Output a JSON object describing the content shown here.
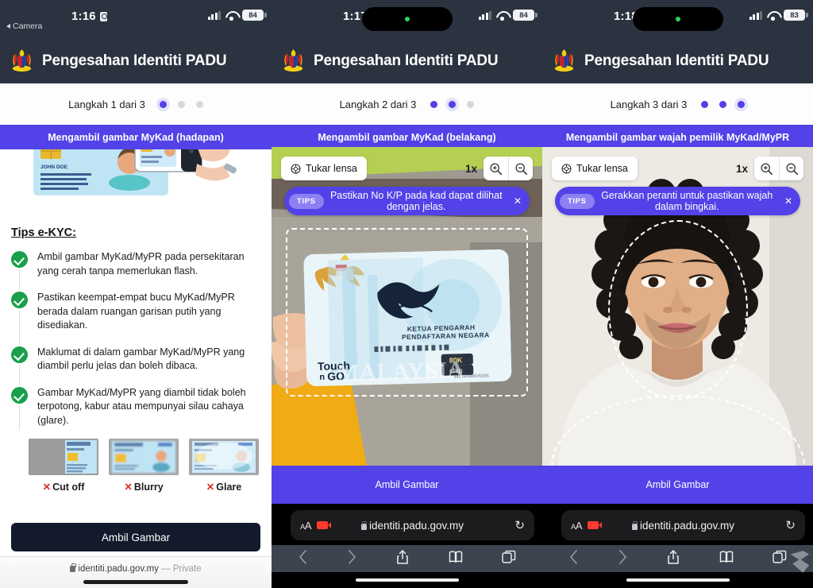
{
  "app": {
    "title": "Pengesahan Identiti PADU",
    "logo_icon": "malaysia-coat-of-arms-icon",
    "url": "identiti.padu.gov.my",
    "private_label": "— Private"
  },
  "panels": [
    {
      "id": "step1",
      "status_bar": {
        "time": "1:16",
        "back_label": "Camera",
        "battery": "84",
        "signal_icon": "cellular-bars-icon",
        "wifi_icon": "wifi-icon",
        "lock_icon": "screen-lock-icon",
        "has_dynamic_island": false
      },
      "step_label": "Langkah 1 dari 3",
      "step_current": 1,
      "step_total": 3,
      "band_title": "Mengambil gambar MyKad (hadapan)",
      "hero_image_alt": "mykad-photo-illustration",
      "tips_title": "Tips e-KYC:",
      "tips": [
        "Ambil gambar MyKad/MyPR pada persekitaran yang cerah tanpa memerlukan flash.",
        "Pastikan keempat-empat bucu MyKad/MyPR berada dalam ruangan garisan putih yang disediakan.",
        "Maklumat di dalam gambar MyKad/MyPR yang diambil perlu jelas dan boleh dibaca.",
        "Gambar MyKad/MyPR yang diambil tidak boleh terpotong, kabur atau mempunyai silau cahaya (glare)."
      ],
      "bad_examples": [
        {
          "label": "Cut off",
          "mark": "✕",
          "thumb": "mykad-cutoff-thumb"
        },
        {
          "label": "Blurry",
          "mark": "✕",
          "thumb": "mykad-blurry-thumb"
        },
        {
          "label": "Glare",
          "mark": "✕",
          "thumb": "mykad-glare-thumb"
        }
      ],
      "capture_button": "Ambil Gambar"
    },
    {
      "id": "step2",
      "status_bar": {
        "time": "1:17",
        "battery": "84",
        "signal_icon": "cellular-bars-icon",
        "wifi_icon": "wifi-icon",
        "lock_icon": "screen-lock-icon",
        "has_dynamic_island": true
      },
      "step_label": "Langkah 2 dari 3",
      "step_current": 2,
      "step_total": 3,
      "band_title": "Mengambil gambar MyKad (belakang)",
      "lens_button": "Tukar lensa",
      "lens_icon": "camera-lens-icon",
      "zoom_level": "1x",
      "zoom_in_icon": "magnifier-plus-icon",
      "zoom_out_icon": "magnifier-minus-icon",
      "tips_pill": "TIPS",
      "tips_message": "Pastikan No K/P pada kad dapat dilihat dengan jelas.",
      "tips_close_icon": "close-icon",
      "guide_shape": "rectangle",
      "capture_button": "Ambil Gambar",
      "browser": {
        "aa_label": "AA",
        "camera_active_icon": "camera-recording-icon",
        "lock_icon": "lock-icon",
        "url": "identiti.padu.gov.my",
        "reload_icon": "reload-icon",
        "tools": [
          "back-icon",
          "forward-icon",
          "share-icon",
          "bookmarks-icon",
          "tabs-icon"
        ]
      }
    },
    {
      "id": "step3",
      "status_bar": {
        "time": "1:18",
        "battery": "83",
        "signal_icon": "cellular-bars-icon",
        "wifi_icon": "wifi-icon",
        "lock_icon": "screen-lock-icon",
        "has_dynamic_island": true
      },
      "step_label": "Langkah 3 dari 3",
      "step_current": 3,
      "step_total": 3,
      "band_title": "Mengambil gambar wajah pemilik MyKad/MyPR",
      "lens_button": "Tukar lensa",
      "lens_icon": "camera-lens-icon",
      "zoom_level": "1x",
      "zoom_in_icon": "magnifier-plus-icon",
      "zoom_out_icon": "magnifier-minus-icon",
      "tips_pill": "TIPS",
      "tips_message": "Gerakkan peranti untuk pastikan wajah dalam bingkai.",
      "tips_close_icon": "close-icon",
      "guide_shape": "face-oval",
      "capture_button": "Ambil Gambar",
      "browser": {
        "aa_label": "AA",
        "camera_active_icon": "camera-recording-icon",
        "lock_icon": "lock-icon",
        "url": "identiti.padu.gov.my",
        "reload_icon": "reload-icon",
        "tools": [
          "back-icon",
          "forward-icon",
          "share-icon",
          "bookmarks-icon",
          "tabs-icon"
        ]
      }
    }
  ],
  "card_overlay": {
    "signature_caption_line1": "KETUA PENGARAH",
    "signature_caption_line2": "PENDAFTARAN NEGARA",
    "brand": "Touch n GO",
    "chip_line1": "80K",
    "chip_line2": "chip",
    "watermark": "MALAYSIA"
  },
  "colors": {
    "status_bg": "#2b3340",
    "accent_purple": "#5242e8",
    "dot_on": "#5142e6",
    "dot_off": "#d8d8dc",
    "check_green": "#18a04a",
    "x_red": "#d93025",
    "dark_button": "#121a2b",
    "toolbar_gray": "#3c4450",
    "battery_green_dot": "#30d158"
  }
}
